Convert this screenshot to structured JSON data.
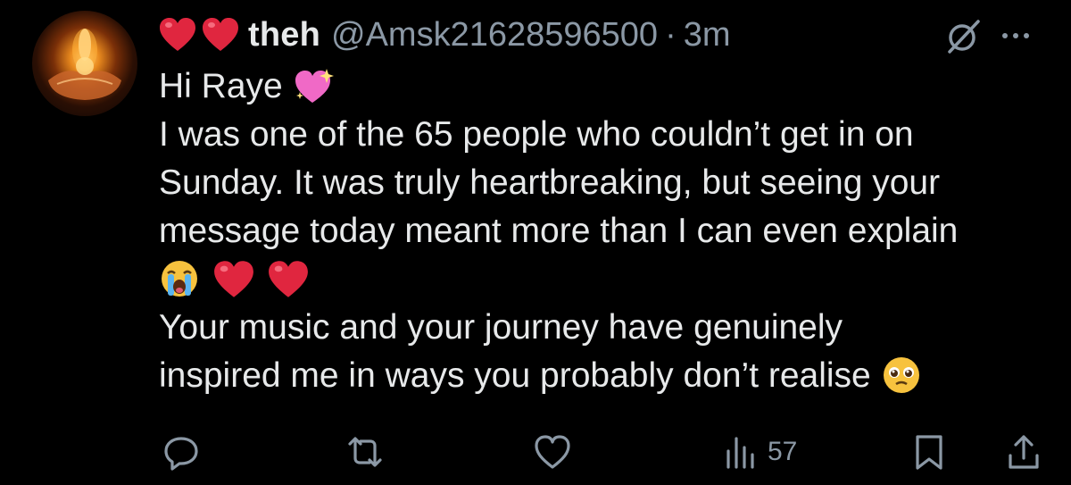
{
  "tweet": {
    "author": {
      "display_name": "theh",
      "handle": "@Amsk21628596500",
      "avatar_icon": "candle-in-hands-avatar",
      "name_prefix_emojis": [
        "red-heart",
        "red-heart"
      ]
    },
    "separator": "·",
    "timestamp": "3m",
    "body": {
      "line1": "Hi Raye",
      "line2": "I was one of the 65 people who couldn’t get in on",
      "line3": "Sunday. It was truly heartbreaking, but seeing your",
      "line4": "message today meant more than I can even explain",
      "line5_emojis": [
        "loudly-crying-face",
        "red-heart",
        "red-heart"
      ],
      "line6": "Your music and your journey have genuinely",
      "line7": "inspired me in ways you probably don’t realise"
    },
    "actions": {
      "reply_icon": "reply-icon",
      "retweet_icon": "retweet-icon",
      "like_icon": "heart-icon",
      "views_icon": "views-icon",
      "views_count": "57",
      "bookmark_icon": "bookmark-icon",
      "share_icon": "share-icon"
    }
  },
  "colors": {
    "background": "#000000",
    "text": "#e7e9ea",
    "secondary": "#8b98a5",
    "heart": "#e0263f",
    "sparkle_heart": "#f069c6"
  }
}
